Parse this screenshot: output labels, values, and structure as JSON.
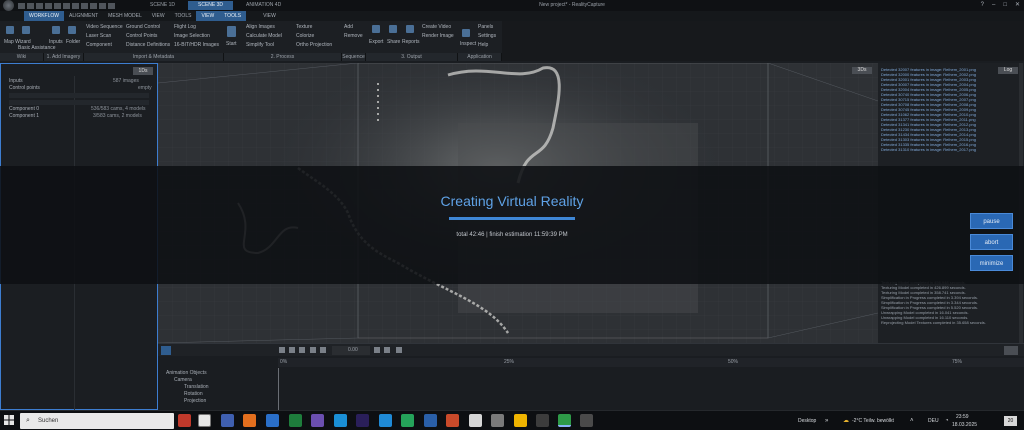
{
  "window": {
    "title": "New project* - RealityCapture",
    "scene_tabs": [
      "SCENE 1D",
      "SCENE 3D",
      "ANIMATION 4D"
    ]
  },
  "menu": [
    "WORKFLOW",
    "ALIGNMENT",
    "MESH MODEL",
    "VIEW",
    "TOOLS",
    "VIEW",
    "TOOLS",
    "VIEW"
  ],
  "ribbon": {
    "wizard": [
      "Map Wizard",
      "Basic Assistance"
    ],
    "add_imagery": [
      "Inputs",
      "Folder"
    ],
    "import_items": [
      "Video Sequence",
      "Laser Scan",
      "Component",
      "Ground Control",
      "Control Points",
      "Distance Definitions",
      "Flight Log",
      "Image Selection",
      "16-BIT/HDR Images"
    ],
    "start": "Start",
    "process_items": [
      "Align Images",
      "Calculate Model",
      "Simplify Tool",
      "Texture",
      "Colorize",
      "Ortho Projection"
    ],
    "sequence_items": [
      "Add",
      "Remove"
    ],
    "output_items": [
      "Export",
      "Share",
      "Reports",
      "Create Video",
      "Render Image"
    ],
    "application_items": [
      "Inspect",
      "Panels",
      "Settings",
      "Help"
    ],
    "group_labels": [
      "Wiki",
      "1. Add Imagery",
      "Import & Metadata",
      "2. Process",
      "Sequence",
      "3. Output",
      "Application"
    ]
  },
  "left_panel": {
    "header_button": "1Ds",
    "tree": [
      {
        "label": "Inputs",
        "value": "587 images"
      },
      {
        "label": "Control points",
        "value": "empty"
      },
      {
        "label": "Component 0",
        "value": "536/583 cams, 4 models"
      },
      {
        "label": "Component 1",
        "value": "3/583 cams, 2 models"
      }
    ]
  },
  "viewport": {
    "label": "3Ds"
  },
  "log": {
    "label": "Log",
    "lines": [
      "Detected 32007 features in image: Reihem_2001.png",
      "Detected 32000 features in image: Reihem_2002.png",
      "Detected 32001 features in image: Reihem_2003.png",
      "Detected 30007 features in image: Reihem_2004.png",
      "Detected 32004 features in image: Reihem_2005.png",
      "Detected 30740 features in image: Reihem_2006.png",
      "Detected 30715 features in image: Reihem_2007.png",
      "Detected 30708 features in image: Reihem_2008.png",
      "Detected 30745 features in image: Reihem_2009.png",
      "Detected 31062 features in image: Reihem_2010.png",
      "Detected 31377 features in image: Reihem_2011.png",
      "Detected 31341 features in image: Reihem_2012.png",
      "Detected 31230 features in image: Reihem_2013.png",
      "Detected 31434 features in image: Reihem_2014.png",
      "Detected 31303 features in image: Reihem_2015.png",
      "Detected 31335 features in image: Reihem_2016.png",
      "Detected 31310 features in image: Reihem_2017.png"
    ],
    "bottom_lines": [
      "Texturing Model completed in 456.948 seconds.",
      "Texturing Model completed in 426.899 seconds.",
      "Texturing Model completed in 358.741 seconds.",
      "Simplification in Progress completed in 3.394 seconds.",
      "Simplification in Progress completed in 3.344 seconds.",
      "Simplification in Progress completed in 5.520 seconds.",
      "Unwrapping Model completed in 16.041 seconds.",
      "Unwrapping Model completed in 16.110 seconds.",
      "Reprojecting Model Textures completed in 35.658 seconds."
    ]
  },
  "overlay": {
    "title": "Creating Virtual Reality",
    "status": "total 42:46 | finish estimation 11:59:39 PM",
    "progress": 1.0,
    "buttons": [
      "pause",
      "abort",
      "minimize"
    ]
  },
  "timeline": {
    "frame_value": "0.00",
    "ticks": [
      "0%",
      "25%",
      "50%",
      "75%"
    ],
    "tree": [
      "Animation Objects",
      "Camera",
      "Translation",
      "Rotation",
      "Projection"
    ]
  },
  "taskbar": {
    "search_placeholder": "Suchen",
    "desktop_label": "Desktop",
    "weather": "-2°C  Teilw. bewölkt",
    "language": "DEU",
    "time": "23:59",
    "date": "18.03.2025",
    "notification_count": "20"
  },
  "colors": {
    "accent": "#2f5d8f",
    "overlay_title": "#5fa2e6",
    "button_blue": "#2a68b4",
    "log_text": "#7fa8d8"
  }
}
